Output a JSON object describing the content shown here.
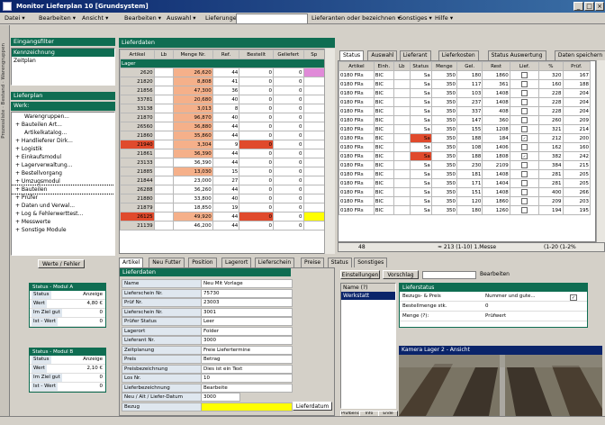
{
  "window": {
    "title": "Monitor Lieferplan 10 [Grundsystem]"
  },
  "menu": {
    "items": [
      "Datei ▾",
      "Bearbeiten ▾",
      "Ansicht ▾",
      "Bearbeiten ▾",
      "Auswahl ▾",
      "Lieferungen",
      "Lieferanten oder bezeichnen ▾",
      "Sonstiges ▾",
      "Hilfe ▾"
    ]
  },
  "left": {
    "header": "Eingangsfilter",
    "filter_items": [
      "Kennzeichnung",
      "Zeitplan"
    ],
    "tree_header": "Lieferplan",
    "tree_root": "Werk:",
    "tree_items": [
      "Warengruppen...",
      "+ Bauteilen Art...",
      "Artikelkatalog...",
      "+ Handlieferer Dirk...",
      "+ Logistik",
      "+ Einkaufsmodul",
      "+ Lagerverwaltung...",
      "+ Bestellvorgang",
      "+ Umzugsmodul",
      "+ Bauteilen",
      "+ Prüfer",
      "+ Daten und Verwal...",
      "+ Log & Fehlerwerttest...",
      "+ Messwerte",
      "+ Sonstige Module"
    ],
    "bottom_tab": "Werte / Fehler",
    "box1_title": "Status - Modul A",
    "box1_rows": [
      [
        "Status",
        "Anzeige"
      ],
      [
        "Wert",
        "4,80 €"
      ],
      [
        "Im Ziel gut",
        "0"
      ],
      [
        "Ist - Wert",
        "0"
      ]
    ],
    "box2_title": "Status - Modul B",
    "box2_rows": [
      [
        "Status",
        "Anzeige"
      ],
      [
        "Wert",
        "2,10 €"
      ],
      [
        "Im Ziel gut",
        "0"
      ],
      [
        "Ist - Wert",
        "0"
      ]
    ],
    "side_tabs": "Prozessliste · Bestand · Warengruppen"
  },
  "middle": {
    "header": "Lieferdaten",
    "columns": [
      "Artikel",
      "Lb",
      "Menge Nr.",
      "Ref.",
      "Bestellt",
      "Geliefert",
      "Sp"
    ],
    "group": "Lager",
    "rows": [
      [
        "2620",
        "26,620",
        "44",
        "0",
        "0"
      ],
      [
        "21820",
        "8,808",
        "41",
        "0",
        "0"
      ],
      [
        "21856",
        "47,300",
        "36",
        "0",
        "0"
      ],
      [
        "33781",
        "20,680",
        "40",
        "0",
        "0"
      ],
      [
        "33138",
        "3,013",
        "8",
        "0",
        "0"
      ],
      [
        "21870",
        "96,870",
        "40",
        "0",
        "0"
      ],
      [
        "26560",
        "36,880",
        "44",
        "0",
        "0"
      ],
      [
        "21860",
        "35,860",
        "44",
        "0",
        "0"
      ],
      [
        "21940",
        "3,304",
        "9",
        "0",
        "0"
      ],
      [
        "21861",
        "36,390",
        "44",
        "0",
        "0"
      ],
      [
        "23133",
        "36,390",
        "44",
        "0",
        "0"
      ],
      [
        "21885",
        "13,030",
        "15",
        "0",
        "0"
      ],
      [
        "21844",
        "23,000",
        "27",
        "0",
        "0"
      ],
      [
        "26288",
        "36,260",
        "44",
        "0",
        "0"
      ],
      [
        "21880",
        "33,800",
        "40",
        "0",
        "0"
      ],
      [
        "21879",
        "18,850",
        "19",
        "0",
        "0"
      ],
      [
        "26125",
        "49,920",
        "44",
        "0",
        "0"
      ],
      [
        "21139",
        "46,200",
        "44",
        "0",
        "0"
      ]
    ],
    "tabs": [
      "Artikel",
      "Neu Futter",
      "Position",
      "Lagerort",
      "Lieferschein",
      "Preise",
      "Status",
      "Sonstiges"
    ],
    "form_header": "Lieferdaten",
    "form": [
      [
        "Name",
        "Neu Mit Vorlage"
      ],
      [
        "Lieferschein Nr.",
        "75730"
      ],
      [
        "Prüf Nr.",
        "23003"
      ],
      [
        "Lieferschein Nr.",
        "3001"
      ],
      [
        "Prüfer Status",
        "Leer"
      ],
      [
        "Lagerort",
        "Folder"
      ],
      [
        "Lieferant Nr.",
        "3000"
      ],
      [
        "Zeitplanung",
        "Freie Liefertermine"
      ],
      [
        "Preis",
        "Betrag"
      ],
      [
        "Preisbezeichnung",
        "Dies ist ein Text"
      ],
      [
        "Los Nr.",
        "10"
      ],
      [
        "Lieferbezeichnung",
        "Bearbeite"
      ],
      [
        "Neu / Alt / Liefer-Datum",
        "3000"
      ],
      [
        "Bezug",
        ""
      ]
    ],
    "form_side_btn": "Lieferdatum"
  },
  "right": {
    "tabs": [
      "Status",
      "Auswahl",
      "Lieferant",
      "Lieferkosten",
      "Status Auswertung",
      "Daten speichern"
    ],
    "columns": [
      "Artikel",
      "Einh.",
      "Lb",
      "Status",
      "Menge",
      "Gel.",
      "Rest",
      "Lief.",
      "%",
      "Prüf."
    ],
    "rows": [
      [
        "0180 FRs",
        "BIC",
        "Sa",
        "350",
        "180",
        "1860",
        "320",
        "167"
      ],
      [
        "0180 FRs",
        "BIC",
        "Sa",
        "350",
        "117",
        "361",
        "160",
        "188"
      ],
      [
        "0180 FRs",
        "BIC",
        "Sa",
        "350",
        "103",
        "1408",
        "228",
        "204"
      ],
      [
        "0180 FRs",
        "BIC",
        "Sa",
        "350",
        "237",
        "1408",
        "228",
        "204"
      ],
      [
        "0180 FRs",
        "BIC",
        "Sa",
        "350",
        "337",
        "408",
        "228",
        "204"
      ],
      [
        "0180 FRs",
        "BIC",
        "Sa",
        "350",
        "147",
        "360",
        "260",
        "209"
      ],
      [
        "0180 FRs",
        "BIC",
        "Sa",
        "350",
        "155",
        "1208",
        "321",
        "214"
      ],
      [
        "0180 FRs",
        "BIC",
        "Sa",
        "350",
        "188",
        "184",
        "212",
        "200"
      ],
      [
        "0180 FRs",
        "BIC",
        "Sa",
        "350",
        "108",
        "1406",
        "162",
        "160"
      ],
      [
        "0180 FRs",
        "BIC",
        "Sa",
        "350",
        "188",
        "1808",
        "382",
        "242"
      ],
      [
        "0180 FRs",
        "BIC",
        "Sa",
        "350",
        "230",
        "2109",
        "384",
        "215"
      ],
      [
        "0180 FRs",
        "BIC",
        "Sa",
        "350",
        "181",
        "1408",
        "281",
        "205"
      ],
      [
        "0180 FRs",
        "BIC",
        "Sa",
        "350",
        "171",
        "1404",
        "281",
        "205"
      ],
      [
        "0180 FRs",
        "BIC",
        "Sa",
        "350",
        "151",
        "1408",
        "400",
        "266"
      ],
      [
        "0180 FRs",
        "BIC",
        "Sa",
        "350",
        "120",
        "1860",
        "209",
        "203"
      ],
      [
        "0180 FRs",
        "BIC",
        "Sa",
        "350",
        "180",
        "1260",
        "194",
        "195"
      ]
    ],
    "footer": [
      "48",
      "≈ 213 (1-10) 1.Messe",
      "(1-20 (1-2%"
    ],
    "sub_btn_a": "Einstellungen",
    "sub_btn_b": "Vorschlag",
    "sub_field": "Bearbeiten",
    "list_header": "Name (?)",
    "list_items": [
      "Werkstatt"
    ],
    "dialog_title": "Lieferstatus",
    "dialog_rows": [
      [
        "Bezugs- & Preis",
        "Nummer und gute..."
      ],
      [
        "Bestellmenge stk.",
        "0"
      ],
      [
        "Menge (?):",
        "Prüfwert"
      ]
    ],
    "cam_title": "Kamera Lager 2 - Ansicht",
    "bottom_btns": [
      "Prüfbericht",
      "Info",
      "Ende"
    ]
  },
  "colors": {
    "accent": "#0f6d52",
    "orange": "#f5b08a",
    "red": "#e04a2c",
    "yellow": "#ffff00",
    "pink": "#e08ad8"
  }
}
